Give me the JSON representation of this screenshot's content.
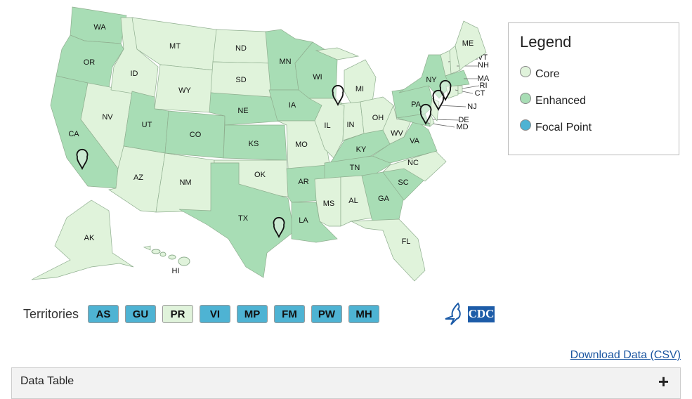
{
  "colors": {
    "core": "#e0f3db",
    "enhanced": "#a8ddb5",
    "focal": "#4eb3d3"
  },
  "legend": {
    "title": "Legend",
    "items": [
      {
        "label": "Core",
        "level": "core"
      },
      {
        "label": "Enhanced",
        "level": "enhanced"
      },
      {
        "label": "Focal Point",
        "level": "focal"
      }
    ]
  },
  "states": {
    "WA": "enhanced",
    "OR": "enhanced",
    "CA": "enhanced",
    "NV": "core",
    "ID": "core",
    "MT": "core",
    "WY": "core",
    "UT": "enhanced",
    "CO": "enhanced",
    "AZ": "core",
    "NM": "core",
    "ND": "core",
    "SD": "core",
    "NE": "enhanced",
    "KS": "enhanced",
    "OK": "core",
    "TX": "enhanced",
    "MN": "enhanced",
    "IA": "enhanced",
    "MO": "core",
    "AR": "enhanced",
    "LA": "enhanced",
    "WI": "enhanced",
    "IL": "core",
    "MI": "core",
    "IN": "core",
    "OH": "core",
    "KY": "enhanced",
    "TN": "enhanced",
    "MS": "core",
    "AL": "core",
    "GA": "enhanced",
    "FL": "core",
    "SC": "enhanced",
    "NC": "core",
    "VA": "enhanced",
    "WV": "core",
    "PA": "enhanced",
    "NY": "enhanced",
    "MD": "enhanced",
    "DE": "core",
    "NJ": "core",
    "VT": "core",
    "NH": "core",
    "ME": "core",
    "MA": "enhanced",
    "CT": "core",
    "RI": "core",
    "AK": "core",
    "HI": "core"
  },
  "territories": {
    "label": "Territories",
    "items": [
      {
        "code": "AS",
        "level": "focal"
      },
      {
        "code": "GU",
        "level": "focal"
      },
      {
        "code": "PR",
        "level": "core"
      },
      {
        "code": "VI",
        "level": "focal"
      },
      {
        "code": "MP",
        "level": "focal"
      },
      {
        "code": "FM",
        "level": "focal"
      },
      {
        "code": "PW",
        "level": "focal"
      },
      {
        "code": "MH",
        "level": "focal"
      }
    ]
  },
  "logo": {
    "text": "CDC"
  },
  "download_label": "Download Data (CSV)",
  "data_table_label": "Data Table",
  "icons": {
    "pin": "map-pin-icon",
    "expand": "plus-icon"
  }
}
